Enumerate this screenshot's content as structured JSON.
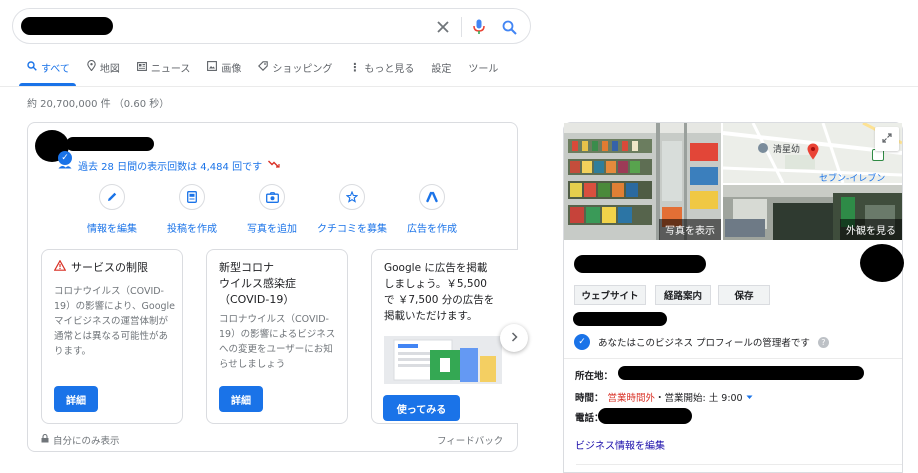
{
  "search": {
    "query": ""
  },
  "tabs": [
    {
      "label": "すべて",
      "icon": "search-icon"
    },
    {
      "label": "地図",
      "icon": "map-pin-icon"
    },
    {
      "label": "ニュース",
      "icon": "news-icon"
    },
    {
      "label": "画像",
      "icon": "image-icon"
    },
    {
      "label": "ショッピング",
      "icon": "tag-icon"
    },
    {
      "label": "もっと見る",
      "icon": "more-vert-icon"
    },
    {
      "label": "設定",
      "icon": ""
    },
    {
      "label": "ツール",
      "icon": ""
    }
  ],
  "result_stats": "約 20,700,000 件 （0.60 秒）",
  "business": {
    "views_text": "過去 28 日間の表示回数は 4,484 回です",
    "actions": [
      {
        "label": "情報を編集",
        "icon": "pencil-icon"
      },
      {
        "label": "投稿を作成",
        "icon": "post-icon"
      },
      {
        "label": "写真を追加",
        "icon": "camera-icon"
      },
      {
        "label": "クチコミを募集",
        "icon": "star-icon"
      },
      {
        "label": "広告を作成",
        "icon": "ads-icon"
      }
    ],
    "cards": [
      {
        "title": "サービスの制限",
        "body": [
          "コロナウイルス（COVID-",
          "19）の影響により、Google",
          "マイビジネスの運営体制が",
          "通常とは異なる可能性があ",
          "ります。"
        ],
        "button": "詳細"
      },
      {
        "title_lines": [
          "新型コロナ",
          "ウイルス感染症",
          "（COVID-19）"
        ],
        "body": [
          "コロナウイルス（COVID-",
          "19）の影響によるビジネス",
          "への変更をユーザーにお知",
          "らせしましょう"
        ],
        "button": "詳細"
      },
      {
        "title_lines": [
          "Google に広告を掲載",
          "しましょう。￥5,500",
          "で ￥7,500 分の広告を",
          "掲載いただけます。"
        ],
        "button": "使ってみる"
      }
    ],
    "footer_left": "自分にのみ表示",
    "footer_right": "フィードバック"
  },
  "knowledge_panel": {
    "photos_label": "写真を表示",
    "exterior_label": "外観を見る",
    "map_labels": [
      "清星幼",
      "セブン-イレブン"
    ],
    "buttons": [
      "ウェブサイト",
      "経路案内",
      "保存"
    ],
    "manager_text": "あなたはこのビジネス プロフィールの管理者です",
    "address_label": "所在地：",
    "hours_label": "時間：",
    "hours_status": "営業時間外",
    "hours_next": "・営業開始: 土 9:00",
    "phone_label": "電話：",
    "edit_link": "ビジネス情報を編集"
  },
  "colors": {
    "accent": "#1a73e8",
    "closed": "#d93025",
    "trend_down": "#d93025"
  }
}
